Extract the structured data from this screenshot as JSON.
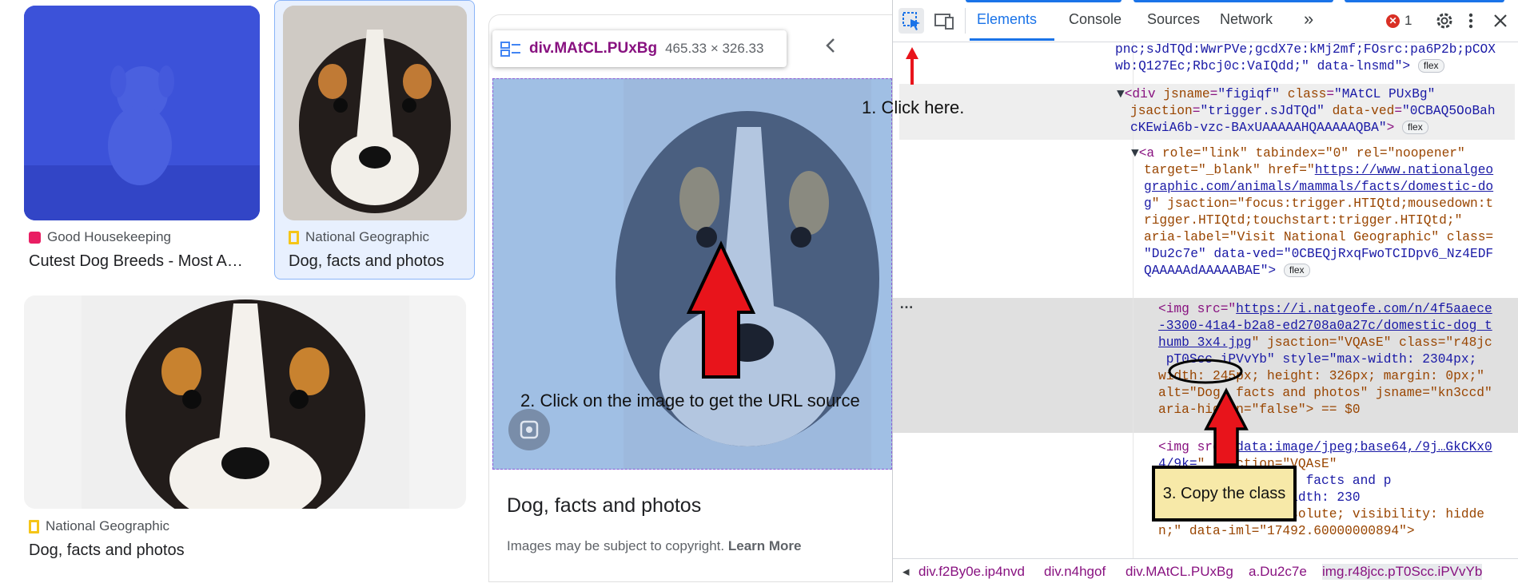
{
  "results": [
    {
      "source": "Good Housekeeping",
      "title": "Cutest Dog Breeds - Most A…",
      "source_icon_color": "#e91e63"
    },
    {
      "source": "National Geographic",
      "title": "Dog, facts and photos",
      "source_icon_color": "#f5c518"
    },
    {
      "source": "National Geographic",
      "title": "Dog, facts and photos",
      "source_icon_color": "#f5c518"
    }
  ],
  "preview": {
    "inspect_tooltip_name": "div.MAtCL.PUxBg",
    "inspect_tooltip_size": "465.33 × 326.33",
    "title": "Dog, facts and photos",
    "copyright_text": "Images may be subject to copyright.",
    "learn_more": "Learn More"
  },
  "devtools": {
    "tabs": [
      "Elements",
      "Console",
      "Sources",
      "Network"
    ],
    "more_tabs": "»",
    "error_count": "1",
    "code_lines": {
      "l0": "pnc;sJdTQd:WwrPVe;gcdX7e:kMj2mf;FOsrc:pa6P2b;pCOX",
      "l1": "wb:Q127Ec;Rbcj0c:VaIQdd;\" data-lnsmd\">",
      "div_open": "<div ",
      "div_jsname": "jsname",
      "div_jsname_val": "\"figiqf\"",
      "div_class": " class",
      "div_class_val": "\"MAtCL PUxBg\"",
      "div_l2": "jsaction",
      "div_l2_val": "\"trigger.sJdTQd\"",
      "div_l2b": " data-ved",
      "div_l2b_val": "\"0CBAQ5OoBah",
      "div_l3": "cKEwiA6b-vzc-BAxUAAAAAHQAAAAAQBA\"",
      "a_open": "<a ",
      "a_l1": "role=\"link\" tabindex=\"0\" rel=\"noopener\"",
      "a_l2a": "target=\"_blank\" href=\"",
      "a_href1": "https://www.nationalgeo",
      "a_href2": "graphic.com/animals/mammals/facts/domestic-do",
      "a_href3": "g",
      "a_l4": "\" jsaction=\"focus:trigger.HTIQtd;mousedown:t",
      "a_l5": "rigger.HTIQtd;touchstart:trigger.HTIQtd;\"",
      "a_l6": "aria-label=\"Visit National Geographic\" class=",
      "a_l7": "\"Du2c7e\" data-ved=\"0CBEQjRxqFwoTCIDpv6_Nz4EDF",
      "a_l8": "QAAAAAdAAAAABAE\">",
      "img_src_pre": "<img src=\"",
      "img_src1": "https://i.natgeofe.com/n/4f5aaece",
      "img_src2": "-3300-41a4-b2a8-ed2708a0a27c/domestic-dog_t",
      "img_src3": "humb_3x4.jpg",
      "img_l4": "\" jsaction=\"VQAsE\" class=\"r48jc",
      "img_l5": " pT0Scc iPVvYb\" style=\"max-width: 2304px;",
      "img_l6": "width: 245px; height: 326px; margin: 0px;\"",
      "img_l7": "alt=\"Dog, facts and photos\" jsname=\"kn3ccd\"",
      "img_l8": "aria-hidden=\"false\"> == $0",
      "img2_pre": "<img src=\"",
      "img2_src1": "data:image/jpeg;base64,/9j…GkCKx0",
      "img2_src2": "4/9k=",
      "img2_l2": "\" jsaction=\"VQAsE\"",
      "img2_l3": " pT0Scc\" alt=\"Dog, facts and p",
      "img2_l4": "Xqh\" style=\"max-width: 230",
      "img2_l5": "4px; position: absolute; visibility: hidde",
      "img2_l6": "n;\" data-iml=\"17492.60000000894\">"
    },
    "flex_badge": "flex",
    "ellipsis": "…",
    "breadcrumbs": [
      "div.f2By0e.ip4nvd",
      "div.n4hgof",
      "div.MAtCL.PUxBg",
      "a.Du2c7e",
      "img.r48jcc.pT0Scc.iPVvYb"
    ]
  },
  "annotations": {
    "step1": "1. Click here.",
    "step2": "2. Click on the image to get the URL source",
    "step3": "3. Copy the class"
  }
}
